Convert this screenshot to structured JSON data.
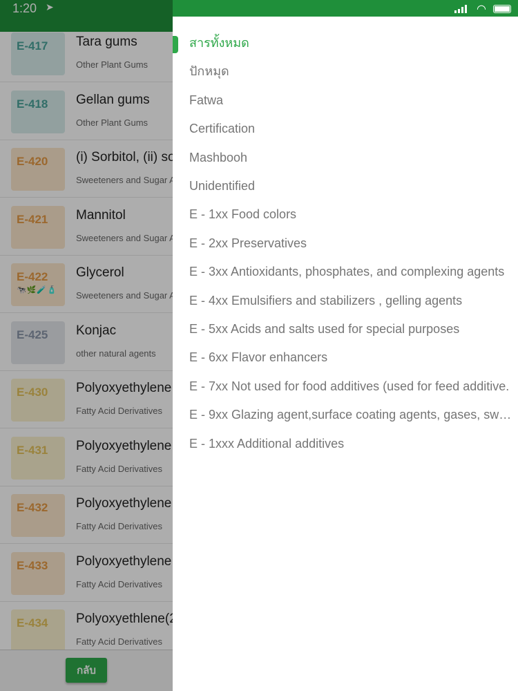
{
  "status_bar": {
    "time": "1:20"
  },
  "list": {
    "rows": [
      {
        "code": "E-417",
        "name": "Tara gums",
        "category": "Other Plant Gums",
        "code_color": "#4aa39a",
        "box_color": "#d7ecea",
        "icons": ""
      },
      {
        "code": "E-418",
        "name": "Gellan gums",
        "category": "Other Plant Gums",
        "code_color": "#4aa39a",
        "box_color": "#d7ecea",
        "icons": ""
      },
      {
        "code": "E-420",
        "name": "(i) Sorbitol, (ii) so",
        "category": "Sweeteners and Sugar A",
        "code_color": "#e59a45",
        "box_color": "#fbe6cc",
        "icons": ""
      },
      {
        "code": "E-421",
        "name": "Mannitol",
        "category": "Sweeteners and Sugar A",
        "code_color": "#e59a45",
        "box_color": "#fbe6cc",
        "icons": ""
      },
      {
        "code": "E-422",
        "name": "Glycerol",
        "category": "Sweeteners and Sugar A",
        "code_color": "#e59a45",
        "box_color": "#fbe6cc",
        "icons": "🐄🌿🧪🧴"
      },
      {
        "code": "E-425",
        "name": "Konjac",
        "category": "other natural agents",
        "code_color": "#8a96a8",
        "box_color": "#e3e6ea",
        "icons": ""
      },
      {
        "code": "E-430",
        "name": "Polyoxyethylene",
        "category": "Fatty Acid Derivatives",
        "code_color": "#e3c25a",
        "box_color": "#faf0cf",
        "icons": ""
      },
      {
        "code": "E-431",
        "name": "Polyoxyethylene",
        "category": "Fatty Acid Derivatives",
        "code_color": "#e3c25a",
        "box_color": "#faf0cf",
        "icons": ""
      },
      {
        "code": "E-432",
        "name": "Polyoxyethylene",
        "category": "Fatty Acid Derivatives",
        "code_color": "#e59a45",
        "box_color": "#fbe6cc",
        "icons": ""
      },
      {
        "code": "E-433",
        "name": "Polyoxyethylene",
        "category": "Fatty Acid Derivatives",
        "code_color": "#e59a45",
        "box_color": "#fbe6cc",
        "icons": ""
      },
      {
        "code": "E-434",
        "name": "Polyoxyethlene(2",
        "category": "Fatty Acid Derivatives",
        "code_color": "#e3c25a",
        "box_color": "#faf0cf",
        "icons": ""
      }
    ]
  },
  "footer": {
    "back_label": "กลับ"
  },
  "drawer": {
    "active_color": "#2fa84a",
    "items": [
      {
        "label": "สารทั้งหมด",
        "active": true
      },
      {
        "label": "ปักหมุด",
        "active": false
      },
      {
        "label": "Fatwa",
        "active": false
      },
      {
        "label": "Certification",
        "active": false
      },
      {
        "label": "Mashbooh",
        "active": false
      },
      {
        "label": "Unidentified",
        "active": false
      },
      {
        "label": "E - 1xx Food colors",
        "active": false
      },
      {
        "label": "E - 2xx Preservatives",
        "active": false
      },
      {
        "label": "E - 3xx Antioxidants, phosphates, and complexing agents",
        "active": false
      },
      {
        "label": "E - 4xx Emulsifiers and stabilizers , gelling agents",
        "active": false
      },
      {
        "label": "E - 5xx Acids and salts used for special purposes",
        "active": false
      },
      {
        "label": "E - 6xx Flavor enhancers",
        "active": false
      },
      {
        "label": "E - 7xx Not used for food additives (used for feed additive.",
        "active": false
      },
      {
        "label": "E - 9xx Glazing agent,surface coating agents, gases, swe...",
        "active": false
      },
      {
        "label": "E - 1xxx Additional additives",
        "active": false
      }
    ]
  }
}
